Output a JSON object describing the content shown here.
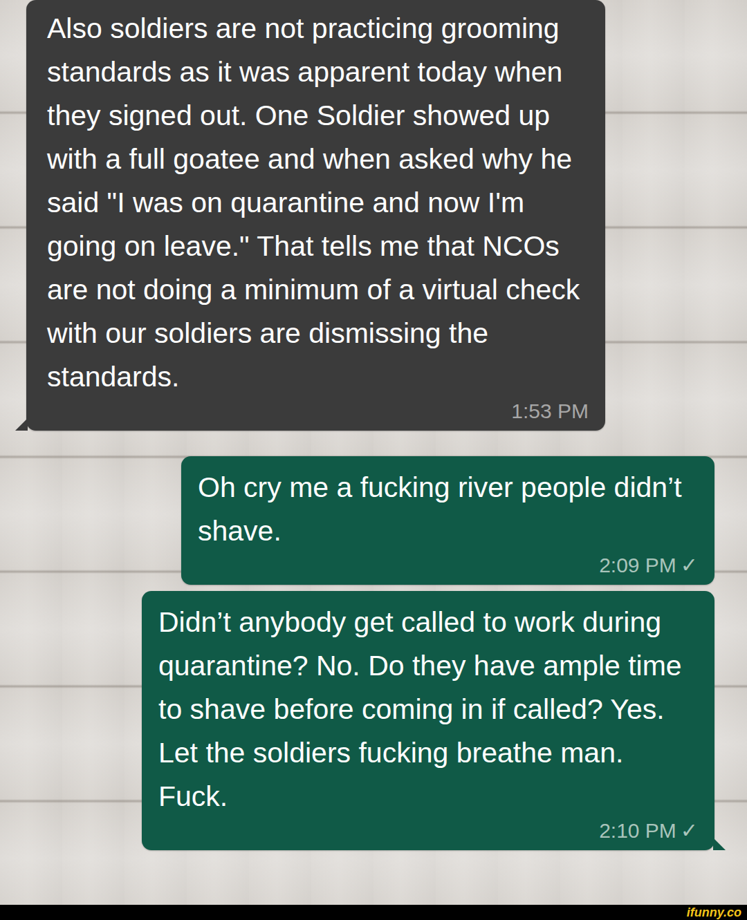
{
  "messages": [
    {
      "kind": "incoming",
      "text": "Also soldiers are not practicing grooming standards as it was apparent today when they signed out. One Soldier showed up with a full goatee and when asked why he said \"I was on quarantine and now I'm going on leave.\" That tells me that NCOs are not doing a minimum of a virtual check with our soldiers are dismissing the standards.",
      "time": "1:53 PM",
      "check": "",
      "tail": true
    },
    {
      "kind": "outgoing",
      "text": "Oh cry me a fucking river people didn’t shave.",
      "time": "2:09 PM",
      "check": "✓",
      "tail": false
    },
    {
      "kind": "outgoing",
      "text": "Didn’t anybody get called to work during quarantine? No. Do they have ample time to shave before coming in if called? Yes. Let the soldiers fucking breathe man. Fuck.",
      "time": "2:10 PM",
      "check": "✓",
      "tail": true
    }
  ],
  "footer": {
    "logo": "ifunny.co"
  }
}
